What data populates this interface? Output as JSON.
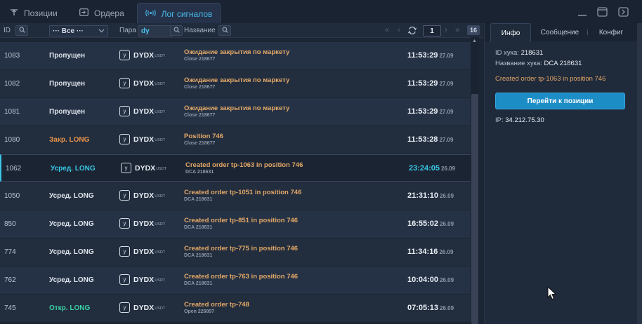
{
  "tabs": [
    {
      "label": "Позиции",
      "icon": "positions-icon"
    },
    {
      "label": "Ордера",
      "icon": "orders-icon"
    },
    {
      "label": "Лог сигналов",
      "icon": "signal-icon"
    }
  ],
  "filters": {
    "id_label": "ID",
    "status_select": "··· Все ···",
    "pair_label": "Пара",
    "pair_value": "dy",
    "name_label": "Название",
    "page": "1",
    "page_count": "16"
  },
  "rows": [
    {
      "id": "1083",
      "status": "Пропущен",
      "status_color": "#dde3ea",
      "pair": "DYDX",
      "quote": "USDT",
      "name": "Ожидание закрытия по маркету",
      "sub": "Close 218677",
      "time": "11:53:29",
      "date": "27.09"
    },
    {
      "id": "1082",
      "status": "Пропущен",
      "status_color": "#dde3ea",
      "pair": "DYDX",
      "quote": "USDT",
      "name": "Ожидание закрытия по маркету",
      "sub": "Close 218677",
      "time": "11:53:29",
      "date": "27.09"
    },
    {
      "id": "1081",
      "status": "Пропущен",
      "status_color": "#dde3ea",
      "pair": "DYDX",
      "quote": "USDT",
      "name": "Ожидание закрытия по маркету",
      "sub": "Close 218677",
      "time": "11:53:29",
      "date": "27.09"
    },
    {
      "id": "1080",
      "status": "Закр. LONG",
      "status_color": "#e8934a",
      "pair": "DYDX",
      "quote": "USDT",
      "name": "Position 746",
      "sub": "Close 218677",
      "time": "11:53:28",
      "date": "27.09"
    },
    {
      "id": "1062",
      "status": "Усред. LONG",
      "status_color": "#39c8e6",
      "pair": "DYDX",
      "quote": "USDT",
      "name": "Created order tp-1063 in position 746",
      "sub": "DCA 218631",
      "time": "23:24:05",
      "date": "26.09",
      "selected": true
    },
    {
      "id": "1050",
      "status": "Усред. LONG",
      "status_color": "#dde3ea",
      "pair": "DYDX",
      "quote": "USDT",
      "name": "Created order tp-1051 in position 746",
      "sub": "DCA 218631",
      "time": "21:31:10",
      "date": "26.09"
    },
    {
      "id": "850",
      "status": "Усред. LONG",
      "status_color": "#dde3ea",
      "pair": "DYDX",
      "quote": "USDT",
      "name": "Created order tp-851 in position 746",
      "sub": "DCA 218631",
      "time": "16:55:02",
      "date": "26.09"
    },
    {
      "id": "774",
      "status": "Усред. LONG",
      "status_color": "#dde3ea",
      "pair": "DYDX",
      "quote": "USDT",
      "name": "Created order tp-775 in position 746",
      "sub": "DCA 218631",
      "time": "11:34:16",
      "date": "26.09"
    },
    {
      "id": "762",
      "status": "Усред. LONG",
      "status_color": "#dde3ea",
      "pair": "DYDX",
      "quote": "USDT",
      "name": "Created order tp-763 in position 746",
      "sub": "DCA 218631",
      "time": "10:04:00",
      "date": "26.09"
    },
    {
      "id": "745",
      "status": "Откр. LONG",
      "status_color": "#39d1a6",
      "pair": "DYDX",
      "quote": "USDT",
      "name": "Created order tp-748",
      "sub": "Open 226897",
      "time": "07:05:13",
      "date": "26.09"
    }
  ],
  "panel": {
    "tabs": [
      "Инфо",
      "Сообщение",
      "Конфиг"
    ],
    "hook_id_label": "ID хука:",
    "hook_id": "218631",
    "hook_name_label": "Название хука:",
    "hook_name": "DCA 218631",
    "message": "Created order tp-1063 in position 746",
    "button": "Перейти к позиции",
    "ip_label": "IP:",
    "ip": "34.212.75.30"
  },
  "colors": {
    "accent": "#49b9e6",
    "button": "#1d8dc6",
    "name_text": "#e3a867"
  }
}
